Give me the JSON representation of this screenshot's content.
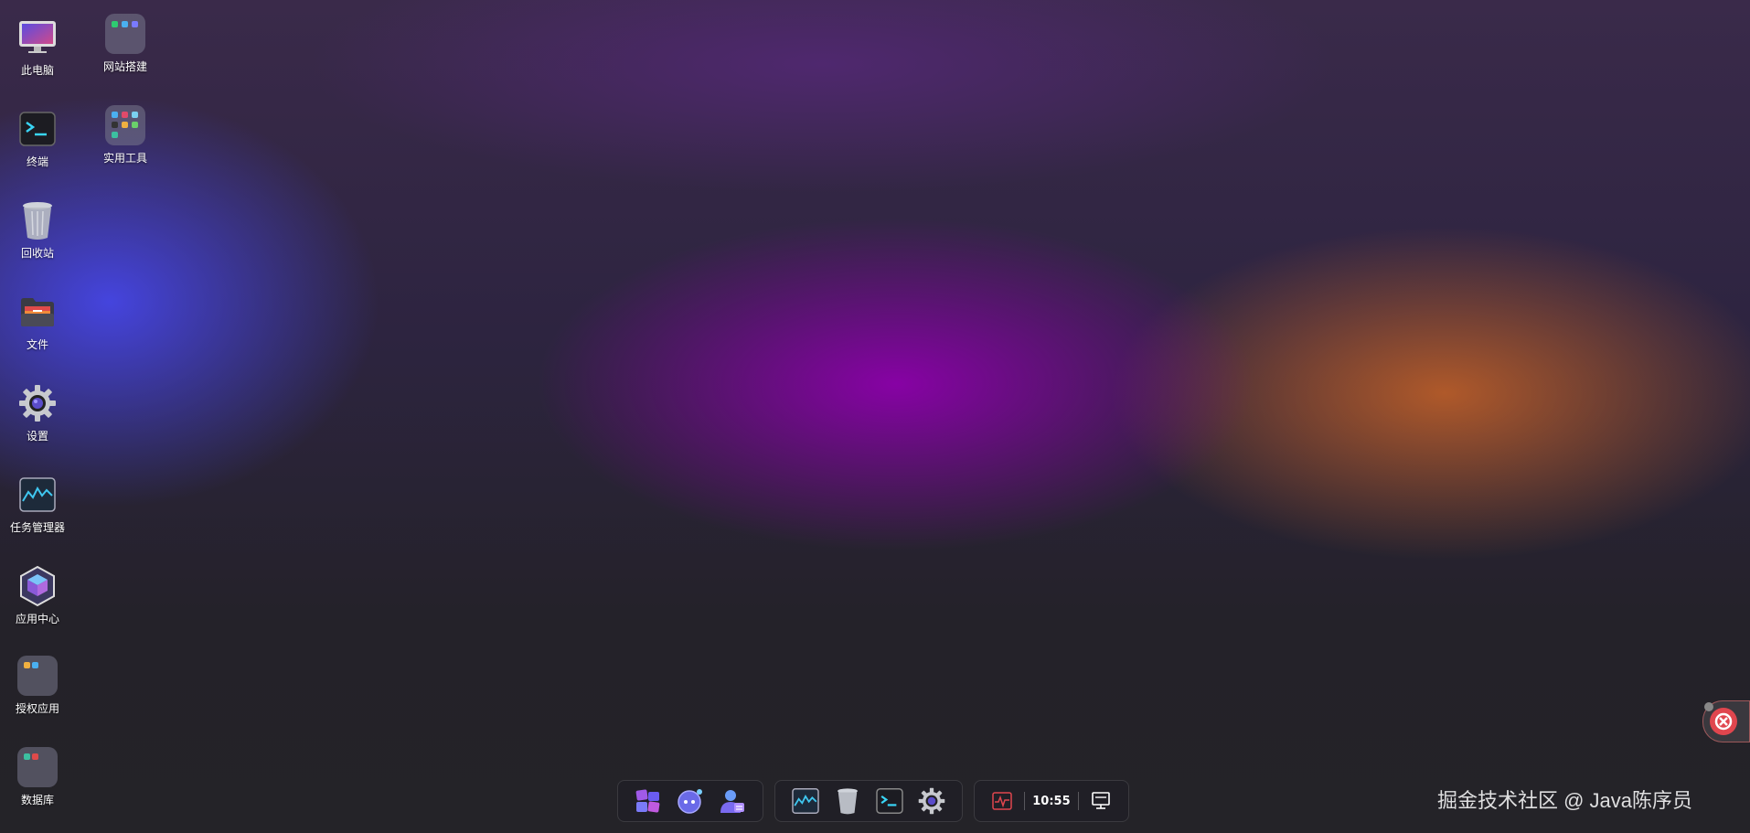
{
  "desktop": {
    "icons": [
      {
        "label": "此电脑",
        "icon": "computer-icon"
      },
      {
        "label": "网站搭建",
        "icon": "folder-icon"
      },
      {
        "label": "终端",
        "icon": "terminal-icon"
      },
      {
        "label": "实用工具",
        "icon": "folder-icon"
      },
      {
        "label": "回收站",
        "icon": "trash-icon"
      },
      {
        "label": "文件",
        "icon": "files-folder-icon"
      },
      {
        "label": "设置",
        "icon": "gear-icon"
      },
      {
        "label": "任务管理器",
        "icon": "task-manager-icon"
      },
      {
        "label": "应用中心",
        "icon": "app-center-icon"
      },
      {
        "label": "授权应用",
        "icon": "folder-icon"
      },
      {
        "label": "数据库",
        "icon": "folder-icon"
      }
    ]
  },
  "taskbar": {
    "group1": [
      "start-menu-icon",
      "assistant-icon",
      "user-icon"
    ],
    "group2": [
      "task-manager-icon",
      "trash-icon",
      "terminal-icon",
      "gear-icon"
    ],
    "clock": "10:55",
    "tray": [
      "monitor-pulse-icon",
      "show-desktop-icon"
    ]
  },
  "watermark": "掘金技术社区 @ Java陈序员",
  "colors": {
    "accent": "#7a2fd0",
    "warning": "#e0464e"
  }
}
